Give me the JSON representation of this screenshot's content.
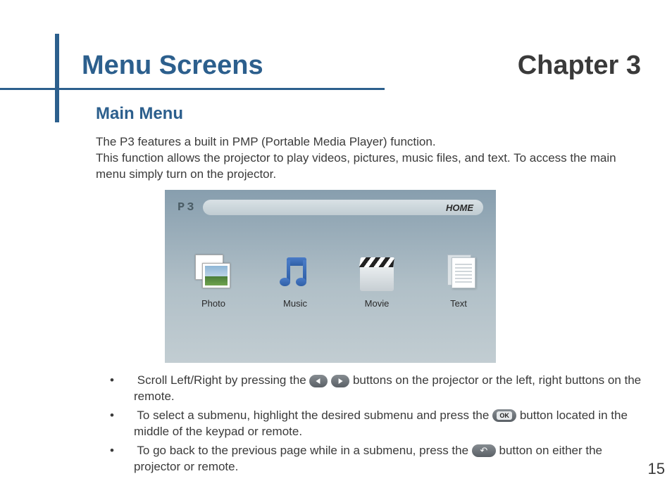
{
  "header": {
    "section_title": "Menu Screens",
    "chapter_label": "Chapter 3"
  },
  "section": {
    "title": "Main Menu",
    "intro_line1": "The P3 features a built in PMP (Portable Media Player) function.",
    "intro_line2": "This function allows the projector to play videos, pictures, music files, and text.  To access the main menu simply turn on the projector."
  },
  "screenshot": {
    "device_logo": "P3",
    "breadcrumb": "HOME",
    "menu_items": [
      {
        "label": "Photo",
        "icon": "photo-icon"
      },
      {
        "label": "Music",
        "icon": "music-icon"
      },
      {
        "label": "Movie",
        "icon": "movie-icon"
      },
      {
        "label": "Text",
        "icon": "text-icon"
      }
    ]
  },
  "bullets": {
    "b1_a": "Scroll Left/Right by pressing the ",
    "b1_b": " buttons on the projector or the left, right buttons on the remote.",
    "b2_a": "To select a submenu, highlight the desired submenu and press the ",
    "b2_b": " button located in the middle of the keypad or remote.",
    "b3_a": "To go back to the previous page while in a submenu, press the ",
    "b3_b": " button on either the projector or remote."
  },
  "page_number": "15"
}
